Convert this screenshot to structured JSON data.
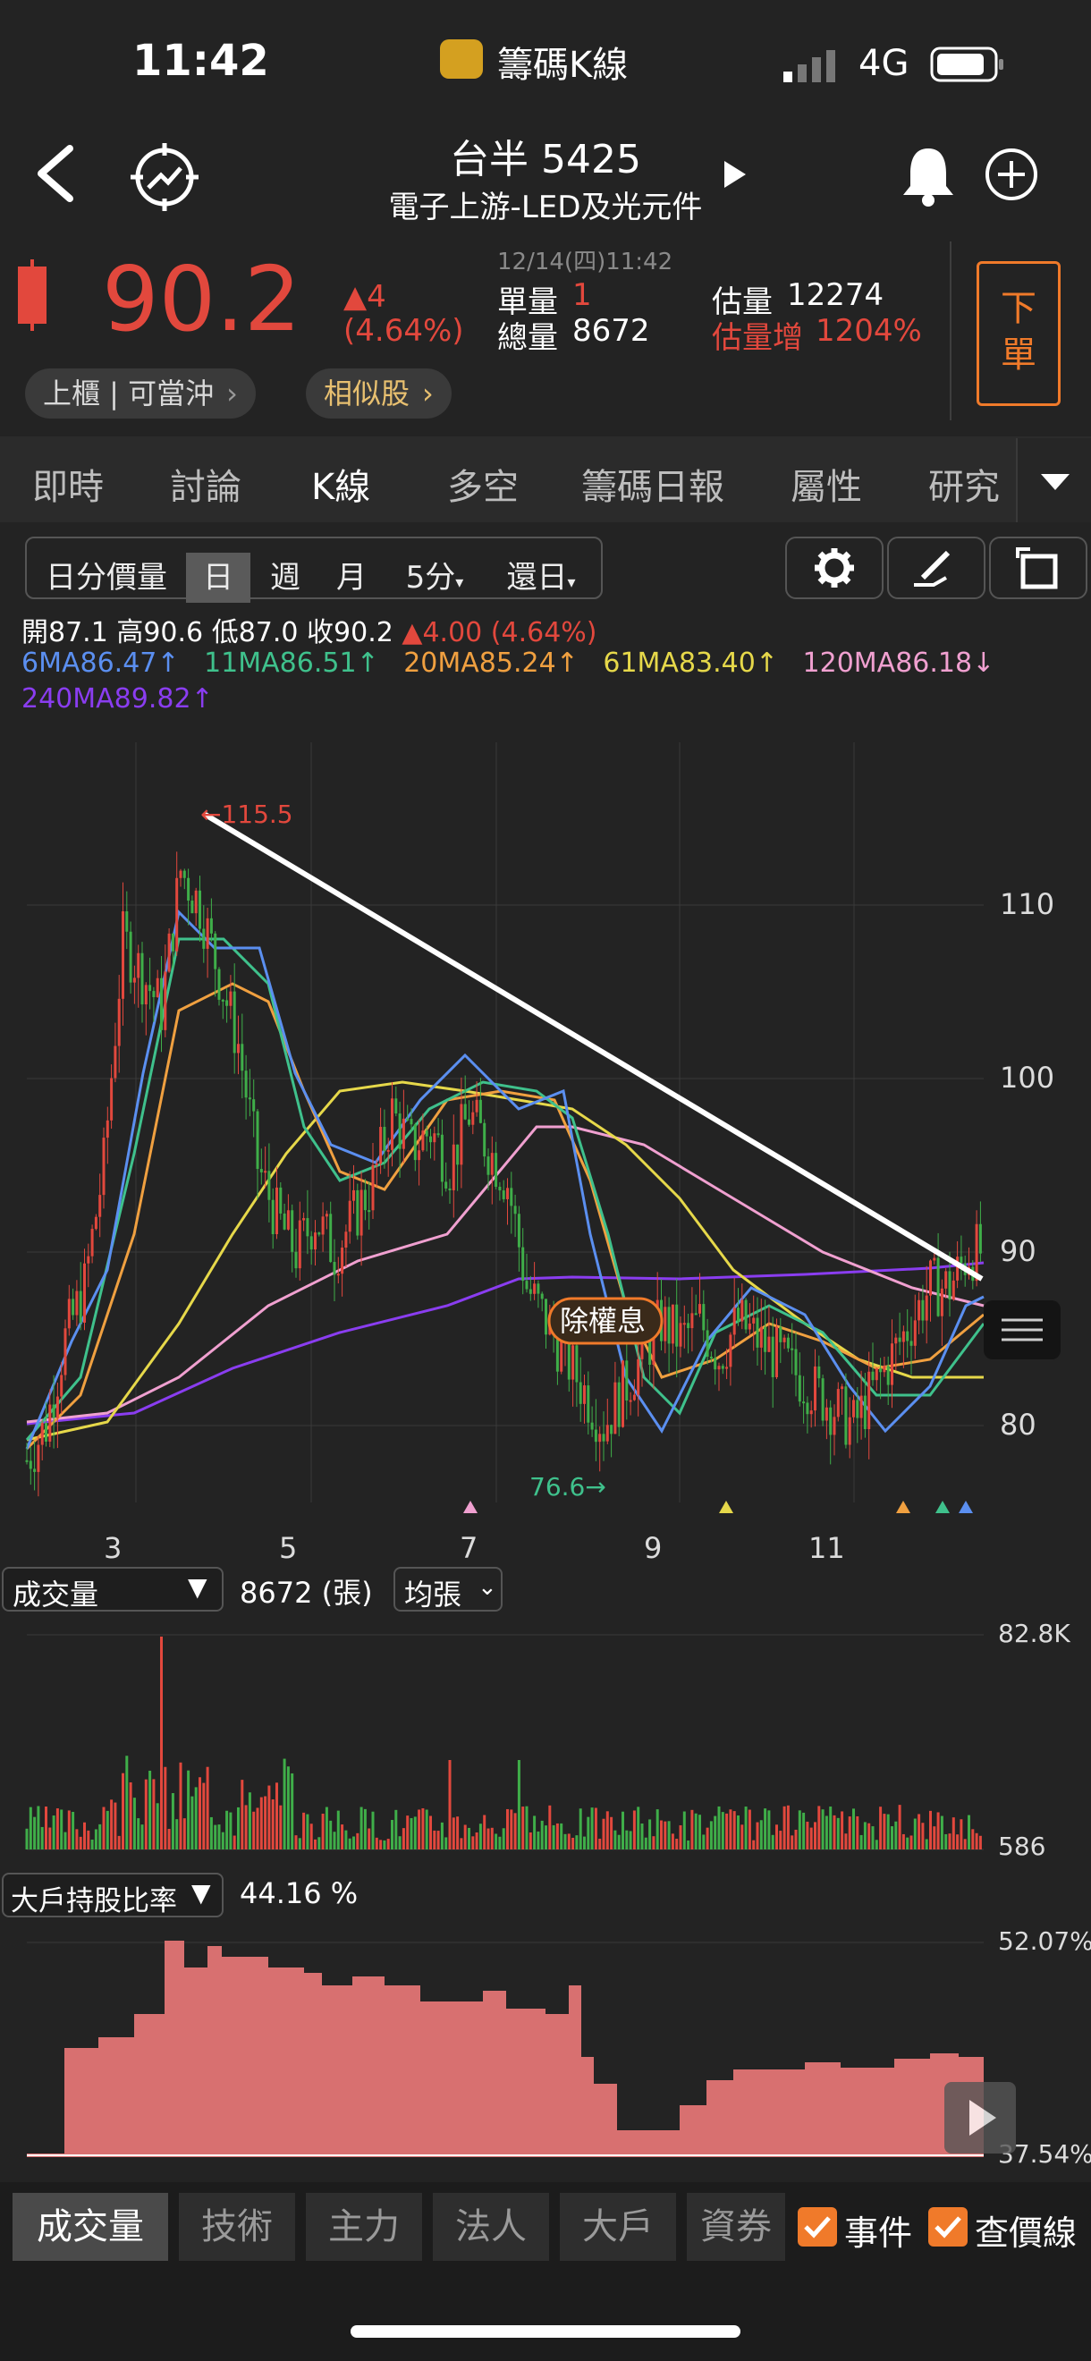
{
  "status_bar": {
    "time": "11:42",
    "app_name": "籌碼K線",
    "network": "4G"
  },
  "header": {
    "title": "台半 5425",
    "subtitle": "電子上游-LED及光元件"
  },
  "quote": {
    "price": "90.2",
    "change": "▲4",
    "change_pct": "(4.64%)",
    "timestamp": "12/14(四)11:42",
    "single_vol_label": "單量",
    "single_vol": "1",
    "total_vol_label": "總量",
    "total_vol": "8672",
    "est_vol_label": "估量",
    "est_vol": "12274",
    "est_increase_label": "估量增",
    "est_increase": "1204%",
    "order_button": "下單",
    "market_tag": "上櫃 | 可當沖",
    "similar_tag": "相似股"
  },
  "tabs": [
    "即時",
    "討論",
    "K線",
    "多空",
    "籌碼日報",
    "屬性",
    "研究"
  ],
  "active_tab": "K線",
  "periods": [
    "日分價量",
    "日",
    "週",
    "月",
    "5分",
    "還日"
  ],
  "active_period": "日",
  "ohlc": {
    "open_label": "開",
    "open": "87.1",
    "high_label": "高",
    "high": "90.6",
    "low_label": "低",
    "low": "87.0",
    "close_label": "收",
    "close": "90.2",
    "change": "▲4.00 (4.64%)"
  },
  "ma": [
    {
      "text": "6MA86.47↑",
      "color": "#5b8ff0"
    },
    {
      "text": "11MA86.51↑",
      "color": "#3fc18c"
    },
    {
      "text": "20MA85.24↑",
      "color": "#f0a040"
    },
    {
      "text": "61MA83.40↑",
      "color": "#e6d84a"
    },
    {
      "text": "120MA86.18↓",
      "color": "#f0a0d0"
    },
    {
      "text": "240MA89.82↑",
      "color": "#8a3df0"
    }
  ],
  "chart_data": {
    "type": "candlestick",
    "y_ticks": [
      "110",
      "100",
      "90",
      "80"
    ],
    "ylim": [
      75,
      117
    ],
    "x_ticks": [
      "3",
      "5",
      "7",
      "9",
      "11"
    ],
    "annotations": {
      "high": "←115.5",
      "low": "76.6→",
      "event": "除權息"
    },
    "close_path": [
      [
        0,
        78
      ],
      [
        5,
        80
      ],
      [
        10,
        85
      ],
      [
        15,
        88
      ],
      [
        20,
        95
      ],
      [
        25,
        108
      ],
      [
        30,
        106
      ],
      [
        35,
        104
      ],
      [
        40,
        112
      ],
      [
        45,
        110
      ],
      [
        50,
        106
      ],
      [
        55,
        102
      ],
      [
        60,
        95
      ],
      [
        65,
        92
      ],
      [
        70,
        90
      ],
      [
        75,
        92
      ],
      [
        80,
        90
      ],
      [
        85,
        92
      ],
      [
        90,
        94
      ],
      [
        95,
        98
      ],
      [
        100,
        96
      ],
      [
        105,
        97
      ],
      [
        110,
        95
      ],
      [
        115,
        98
      ],
      [
        120,
        96
      ],
      [
        125,
        94
      ],
      [
        130,
        88
      ],
      [
        135,
        86
      ],
      [
        140,
        84
      ],
      [
        145,
        82
      ],
      [
        150,
        80
      ],
      [
        155,
        82
      ],
      [
        160,
        84
      ],
      [
        165,
        86
      ],
      [
        170,
        85
      ],
      [
        175,
        86
      ],
      [
        180,
        84
      ],
      [
        185,
        86
      ],
      [
        190,
        85
      ],
      [
        195,
        84
      ],
      [
        200,
        83
      ],
      [
        205,
        82
      ],
      [
        210,
        81
      ],
      [
        215,
        80
      ],
      [
        220,
        82
      ],
      [
        225,
        84
      ],
      [
        230,
        86
      ],
      [
        235,
        88
      ],
      [
        240,
        88
      ],
      [
        245,
        90
      ]
    ],
    "volume": {
      "label": "成交量",
      "value": "8672 (張)",
      "avg": "均張",
      "ymax": "82.8K",
      "ymin": "586"
    },
    "holder": {
      "label": "大戶持股比率",
      "value": "44.16 %",
      "ymax": "52.07%",
      "ymin": "37.54%"
    }
  },
  "bottom_tabs": [
    "成交量",
    "技術",
    "主力",
    "法人",
    "大戶",
    "資券"
  ],
  "checkboxes": [
    {
      "label": "事件",
      "checked": true
    },
    {
      "label": "查價線",
      "checked": true
    }
  ]
}
